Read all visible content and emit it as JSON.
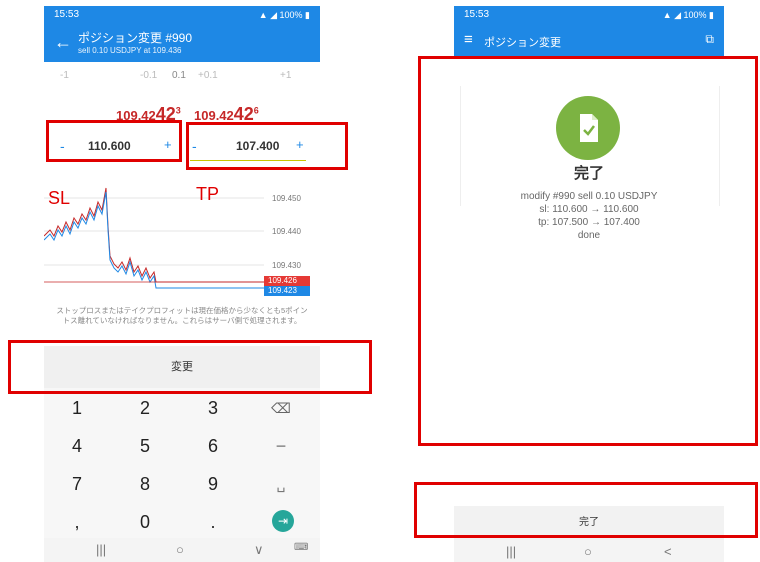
{
  "left": {
    "status": {
      "time": "15:53",
      "right": "©ᵀ \"∂∙ı 100%"
    },
    "header": {
      "title": "ポジション変更 #990",
      "subtitle": "sell 0.10 USDJPY at 109.436"
    },
    "stepper": {
      "labels": [
        "-1",
        "-0.1",
        "0.1",
        "+0.1",
        "+1"
      ]
    },
    "prices": {
      "bid_main": "109.42",
      "bid_sup": "3",
      "ask_main": "109.42",
      "ask_sup": "6"
    },
    "sl": {
      "minus": "-",
      "value": "110.600",
      "plus": "+"
    },
    "tp": {
      "minus": "-",
      "value": "107.400",
      "plus": "+"
    },
    "annot": {
      "sl": "SL",
      "tp": "TP"
    },
    "chart": {
      "axis_labels": [
        "109.450",
        "109.440",
        "109.430"
      ],
      "tag_red": "109.426",
      "tag_blue": "109.423"
    },
    "notice": "ストップロスまたはテイクプロフィットは現在価格から少なくとも5ポイントス離れていなければなりません。これらはサーバ側で処理されます。",
    "modify_button": "変更",
    "keypad": {
      "row1": [
        "1",
        "2",
        "3",
        "⌫"
      ],
      "row2": [
        "4",
        "5",
        "6",
        "−"
      ],
      "row3": [
        "7",
        "8",
        "9",
        "␣"
      ],
      "row4": [
        ",",
        "0",
        ".",
        "⇥"
      ]
    },
    "nav": {
      "recent": "|||",
      "home": "○",
      "back": "∨",
      "kbd": "⌨"
    }
  },
  "right": {
    "status": {
      "time": "15:53",
      "right": "100%"
    },
    "header": {
      "title": "ポジション変更"
    },
    "done_title": "完了",
    "result_lines": [
      "modify #990 sell 0.10 USDJPY",
      "sl: 110.600 → 110.600",
      "tp: 107.500 → 107.400",
      "done"
    ],
    "done_button": "完了",
    "nav": {
      "recent": "|||",
      "home": "○",
      "back": "<"
    }
  },
  "colors": {
    "accent": "#1e88e5",
    "red": "#e00000",
    "success": "#7cb342",
    "bid": "#c62828"
  },
  "icons": {
    "back": "arrow-left-icon",
    "menu": "menu-icon",
    "copy": "copy-icon",
    "done": "document-check-icon"
  }
}
